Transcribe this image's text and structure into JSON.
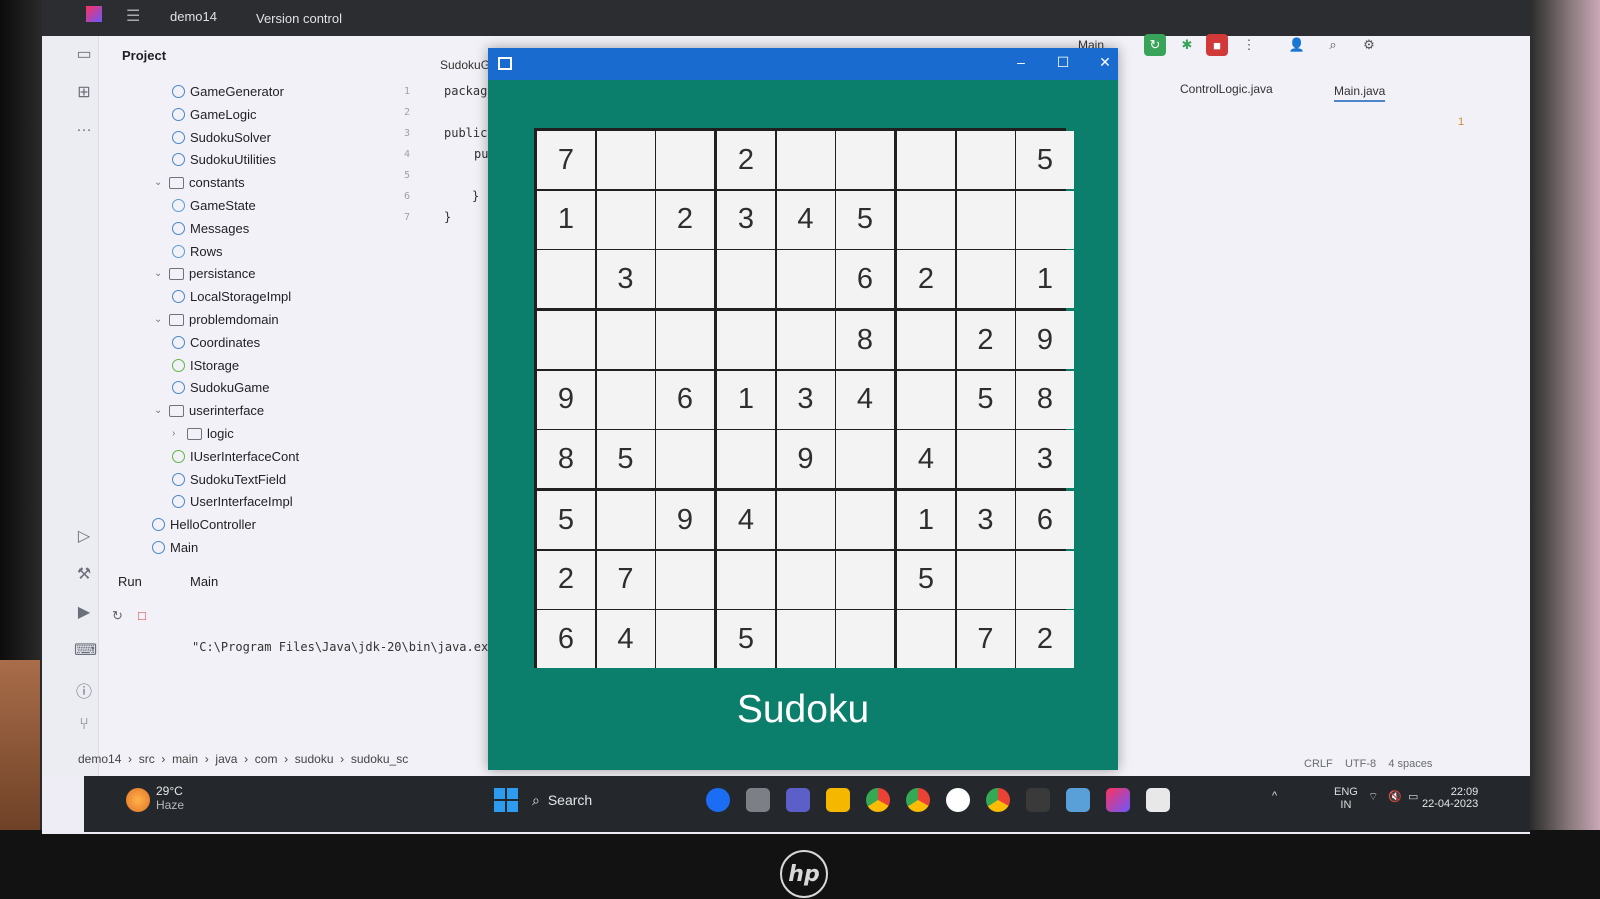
{
  "ide": {
    "project_name": "demo14",
    "version_control": "Version control",
    "run_config": "Main",
    "project_label": "Project",
    "tree": [
      {
        "label": "GameGenerator",
        "kind": "class"
      },
      {
        "label": "GameLogic",
        "kind": "class"
      },
      {
        "label": "SudokuSolver",
        "kind": "class"
      },
      {
        "label": "SudokuUtilities",
        "kind": "class"
      },
      {
        "label": "constants",
        "kind": "folder"
      },
      {
        "label": "GameState",
        "kind": "enum"
      },
      {
        "label": "Messages",
        "kind": "class"
      },
      {
        "label": "Rows",
        "kind": "enum"
      },
      {
        "label": "persistance",
        "kind": "folder"
      },
      {
        "label": "LocalStorageImpl",
        "kind": "class"
      },
      {
        "label": "problemdomain",
        "kind": "folder"
      },
      {
        "label": "Coordinates",
        "kind": "class"
      },
      {
        "label": "IStorage",
        "kind": "interface"
      },
      {
        "label": "SudokuGame",
        "kind": "class"
      },
      {
        "label": "userinterface",
        "kind": "folder"
      },
      {
        "label": "logic",
        "kind": "folder"
      },
      {
        "label": "IUserInterfaceCont",
        "kind": "interface"
      },
      {
        "label": "SudokuTextField",
        "kind": "class"
      },
      {
        "label": "UserInterfaceImpl",
        "kind": "class"
      },
      {
        "label": "HelloController",
        "kind": "class"
      },
      {
        "label": "Main",
        "kind": "class"
      }
    ],
    "editor_tab": "SudokuG",
    "editor_lines": [
      "packag",
      "",
      "public",
      "pu",
      "",
      "}",
      "}"
    ],
    "right_tabs": [
      "ControlLogic.java",
      "Main.java"
    ],
    "warning_count": "1",
    "run_tab_run": "Run",
    "run_tab_main": "Main",
    "run_command": "\"C:\\Program Files\\Java\\jdk-20\\bin\\java.exe\"",
    "breadcrumbs": [
      "demo14",
      "src",
      "main",
      "java",
      "com",
      "sudoku",
      "sudoku_sc"
    ],
    "status": {
      "line_sep": "CRLF",
      "encoding": "UTF-8",
      "indent": "4 spaces"
    }
  },
  "sudoku": {
    "title": "Sudoku",
    "grid": [
      [
        "7",
        "",
        "",
        "2",
        "",
        "",
        "",
        "",
        "5"
      ],
      [
        "1",
        "",
        "2",
        "3",
        "4",
        "5",
        "",
        "",
        ""
      ],
      [
        "",
        "3",
        "",
        "",
        "",
        "6",
        "2",
        "",
        "1"
      ],
      [
        "",
        "",
        "",
        "",
        "",
        "8",
        "",
        "2",
        "9"
      ],
      [
        "9",
        "",
        "6",
        "1",
        "3",
        "4",
        "",
        "5",
        "8"
      ],
      [
        "8",
        "5",
        "",
        "",
        "9",
        "",
        "4",
        "",
        "3"
      ],
      [
        "5",
        "",
        "9",
        "4",
        "",
        "",
        "1",
        "3",
        "6"
      ],
      [
        "2",
        "7",
        "",
        "",
        "",
        "",
        "5",
        "",
        ""
      ],
      [
        "6",
        "4",
        "",
        "5",
        "",
        "",
        "",
        "7",
        "2"
      ]
    ]
  },
  "taskbar": {
    "weather_temp": "29°C",
    "weather_cond": "Haze",
    "search_label": "Search",
    "lang_top": "ENG",
    "lang_bottom": "IN",
    "time": "22:09",
    "date": "22-04-2023"
  },
  "colors": {
    "sudoku_bg": "#0c7f6c",
    "sudoku_titlebar": "#1a6bd0",
    "ide_dark": "#2b2d30"
  }
}
